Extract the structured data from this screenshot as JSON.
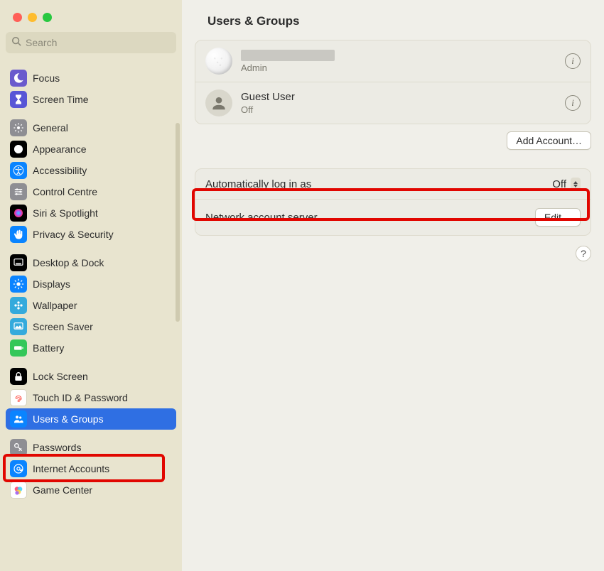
{
  "window": {
    "title": "Users & Groups"
  },
  "search": {
    "placeholder": "Search"
  },
  "sidebar": {
    "groups": [
      {
        "items": [
          {
            "id": "focus",
            "label": "Focus",
            "color": "#6a5acd",
            "icon": "moon"
          },
          {
            "id": "screen-time",
            "label": "Screen Time",
            "color": "#5856d6",
            "icon": "hourglass"
          }
        ]
      },
      {
        "items": [
          {
            "id": "general",
            "label": "General",
            "color": "#8e8e93",
            "icon": "gear"
          },
          {
            "id": "appearance",
            "label": "Appearance",
            "color": "#000000",
            "icon": "appearance"
          },
          {
            "id": "accessibility",
            "label": "Accessibility",
            "color": "#0a84ff",
            "icon": "accessibility"
          },
          {
            "id": "control-centre",
            "label": "Control Centre",
            "color": "#8e8e93",
            "icon": "sliders"
          },
          {
            "id": "siri",
            "label": "Siri & Spotlight",
            "color": "#000000",
            "icon": "siri"
          },
          {
            "id": "privacy",
            "label": "Privacy & Security",
            "color": "#0a84ff",
            "icon": "hand"
          }
        ]
      },
      {
        "items": [
          {
            "id": "desktop-dock",
            "label": "Desktop & Dock",
            "color": "#000000",
            "icon": "dock"
          },
          {
            "id": "displays",
            "label": "Displays",
            "color": "#0a84ff",
            "icon": "sun"
          },
          {
            "id": "wallpaper",
            "label": "Wallpaper",
            "color": "#34aadc",
            "icon": "flower"
          },
          {
            "id": "screen-saver",
            "label": "Screen Saver",
            "color": "#34aadc",
            "icon": "screensaver"
          },
          {
            "id": "battery",
            "label": "Battery",
            "color": "#34c759",
            "icon": "battery"
          }
        ]
      },
      {
        "items": [
          {
            "id": "lock-screen",
            "label": "Lock Screen",
            "color": "#000000",
            "icon": "lock"
          },
          {
            "id": "touch-id",
            "label": "Touch ID & Password",
            "color": "#ffffff",
            "icon": "fingerprint"
          },
          {
            "id": "users-groups",
            "label": "Users & Groups",
            "color": "#0a84ff",
            "icon": "users",
            "selected": true
          }
        ]
      },
      {
        "items": [
          {
            "id": "passwords",
            "label": "Passwords",
            "color": "#8e8e93",
            "icon": "key"
          },
          {
            "id": "internet-accounts",
            "label": "Internet Accounts",
            "color": "#0a84ff",
            "icon": "at"
          },
          {
            "id": "game-center",
            "label": "Game Center",
            "color": "#ffffff",
            "icon": "gamecenter"
          }
        ]
      }
    ]
  },
  "users": [
    {
      "name_redacted": true,
      "role": "Admin",
      "avatar": "golf"
    },
    {
      "name": "Guest User",
      "role": "Off",
      "avatar": "guest"
    }
  ],
  "buttons": {
    "add_account": "Add Account…",
    "edit": "Edit…",
    "help": "?"
  },
  "settings": {
    "auto_login": {
      "label": "Automatically log in as",
      "value": "Off"
    },
    "network_server": {
      "label": "Network account server"
    }
  },
  "highlights": {
    "sidebar_item": "users-groups",
    "setting": "auto_login"
  }
}
